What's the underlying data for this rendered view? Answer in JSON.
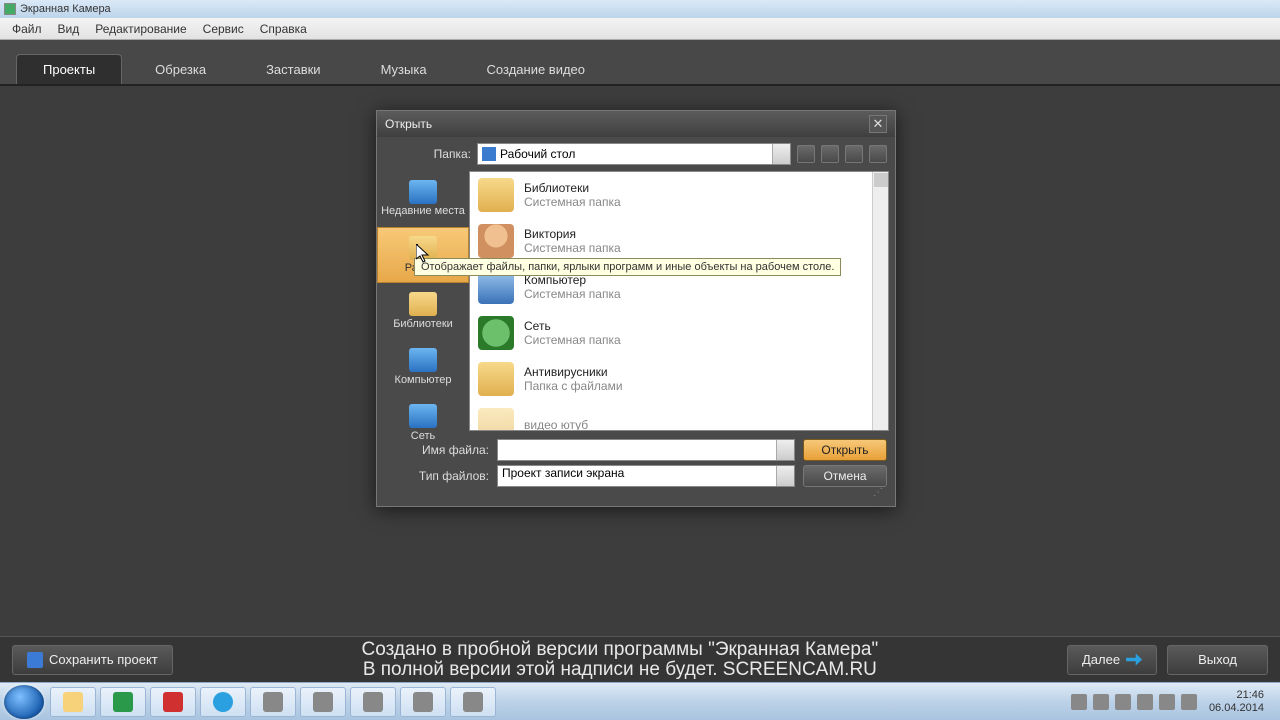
{
  "window": {
    "title": "Экранная Камера"
  },
  "menu": {
    "items": [
      "Файл",
      "Вид",
      "Редактирование",
      "Сервис",
      "Справка"
    ]
  },
  "tabs": {
    "items": [
      "Проекты",
      "Обрезка",
      "Заставки",
      "Музыка",
      "Создание видео"
    ],
    "active": 0
  },
  "bottom": {
    "save": "Сохранить проект",
    "trial_line1": "Создано в пробной версии программы \"Экранная Камера\"",
    "trial_line2": "В полной версии этой надписи не будет. SCREENCAM.RU",
    "next": "Далее",
    "exit": "Выход"
  },
  "dialog": {
    "title": "Открыть",
    "folder_label": "Папка:",
    "folder_value": "Рабочий стол",
    "places": [
      {
        "label": "Недавние места"
      },
      {
        "label": "Рабо…"
      },
      {
        "label": "Библиотеки"
      },
      {
        "label": "Компьютер"
      },
      {
        "label": "Сеть"
      }
    ],
    "items": [
      {
        "name": "Библиотеки",
        "sub": "Системная папка",
        "kind": "lib"
      },
      {
        "name": "Виктория",
        "sub": "Системная папка",
        "kind": "user"
      },
      {
        "name": "Компьютер",
        "sub": "Системная папка",
        "kind": "pc"
      },
      {
        "name": "Сеть",
        "sub": "Системная папка",
        "kind": "net"
      },
      {
        "name": "Антивирусники",
        "sub": "Папка с файлами",
        "kind": "folder"
      },
      {
        "name": "видео ютуб",
        "sub": "",
        "kind": "folder"
      }
    ],
    "filename_label": "Имя файла:",
    "filename_value": "",
    "filetype_label": "Тип файлов:",
    "filetype_value": "Проект записи экрана",
    "open_btn": "Открыть",
    "cancel_btn": "Отмена",
    "tooltip": "Отображает файлы, папки, ярлыки программ и иные объекты на рабочем столе."
  },
  "taskbar": {
    "clock_time": "21:46",
    "clock_date": "06.04.2014"
  }
}
